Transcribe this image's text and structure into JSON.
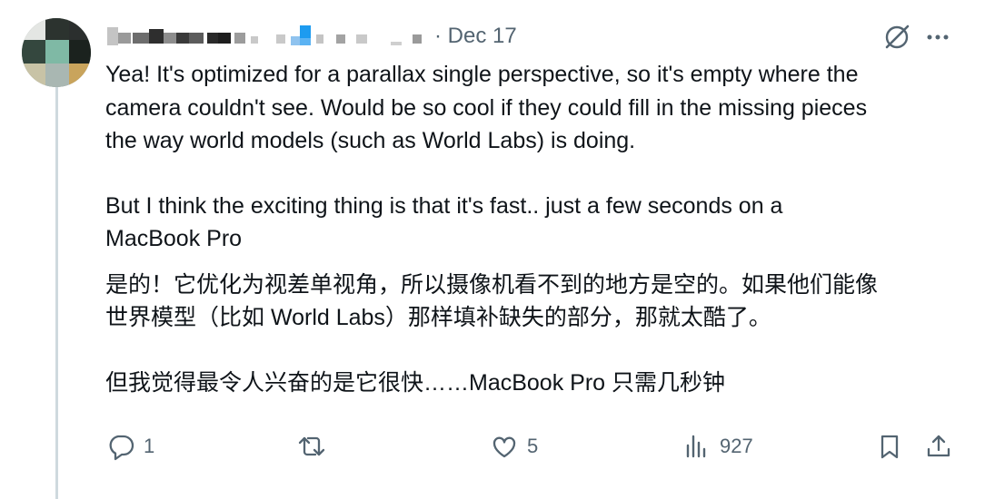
{
  "tweet": {
    "author_name": "",
    "date": "· Dec 17",
    "paragraphs": [
      "Yea! It's optimized for a parallax single perspective, so it's empty where the",
      "camera couldn't see. Would be so cool if they could fill in the missing pieces",
      "the way world models (such as World Labs) is doing."
    ],
    "paragraph2": [
      "But I think the exciting thing is that it's fast.. just a few seconds on a",
      "MacBook Pro"
    ],
    "translation_1": [
      "是的！它优化为视差单视角，所以摄像机看不到的地方是空的。如果他们能像",
      "世界模型（比如 World Labs）那样填补缺失的部分，那就太酷了。"
    ],
    "translation_2": "但我觉得最令人兴奋的是它很快……MacBook Pro 只需几秒钟"
  },
  "actions": {
    "reply_count": "1",
    "retweet_count": "",
    "like_count": "5",
    "views_count": "927"
  },
  "icons": {
    "grok": "grok-icon",
    "more": "more-icon",
    "reply": "reply-icon",
    "retweet": "retweet-icon",
    "like": "heart-icon",
    "views": "views-icon",
    "bookmark": "bookmark-icon",
    "share": "share-icon"
  },
  "colors": {
    "text": "#0f1419",
    "secondary": "#536471",
    "thread_line": "#cfd9de",
    "blur_accent": "#1d9bf0"
  }
}
